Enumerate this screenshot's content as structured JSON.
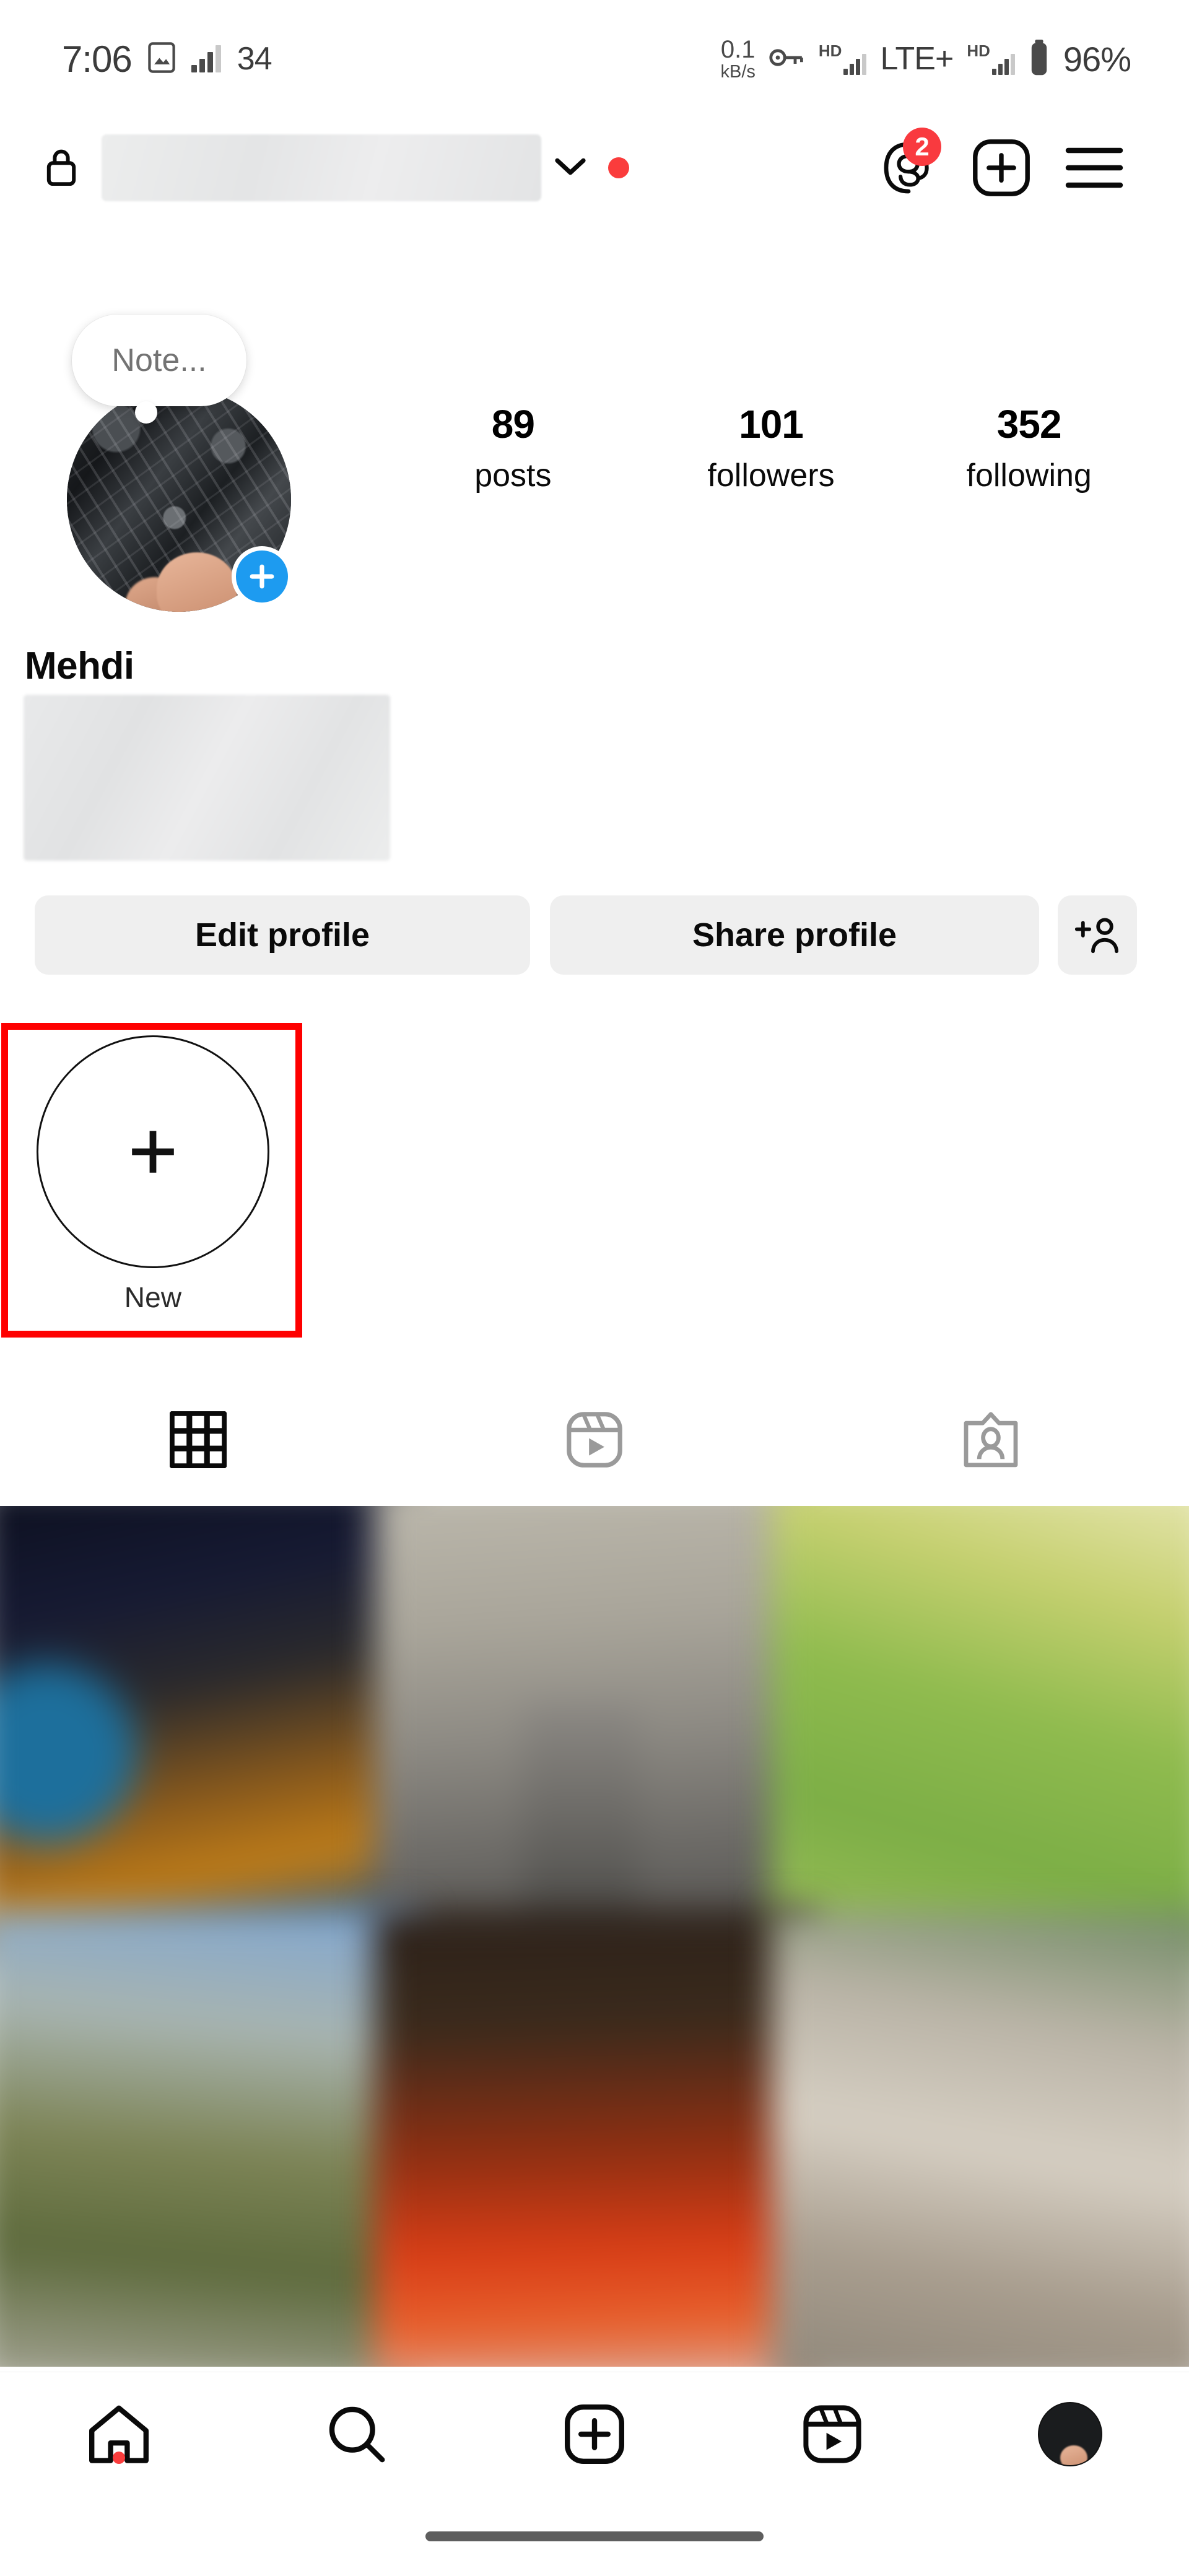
{
  "status_bar": {
    "time": "7:06",
    "gallery_icon": "image-icon",
    "signal_icon": "signal-bars-icon",
    "temperature": "34",
    "data_speed_value": "0.1",
    "data_speed_unit": "kB/s",
    "vpn_icon": "key-icon",
    "hd_label_1": "HD",
    "network_type": "LTE+",
    "hd_label_2": "HD",
    "battery_icon": "battery-icon",
    "battery_percent": "96%"
  },
  "header": {
    "lock_icon": "lock-icon",
    "username_redacted": true,
    "chevron_icon": "chevron-down-icon",
    "activity_dot": true,
    "threads_icon": "threads-icon",
    "threads_badge": "2",
    "create_icon": "plus-square-icon",
    "menu_icon": "hamburger-menu-icon"
  },
  "profile": {
    "note_text": "Note...",
    "avatar_icon": "profile-avatar",
    "add_story_icon": "plus-icon",
    "display_name": "Mehdi",
    "bio_redacted": true,
    "stats": [
      {
        "number": "89",
        "label": "posts"
      },
      {
        "number": "101",
        "label": "followers"
      },
      {
        "number": "352",
        "label": "following"
      }
    ]
  },
  "actions": {
    "edit_profile": "Edit profile",
    "share_profile": "Share profile",
    "add_user_icon": "add-person-icon"
  },
  "highlights": {
    "new_label": "New",
    "new_icon": "plus-icon",
    "annotation_color": "#FE0000"
  },
  "content_tabs": [
    {
      "name": "grid",
      "icon": "grid-icon",
      "active": true
    },
    {
      "name": "reels",
      "icon": "reels-icon",
      "active": false
    },
    {
      "name": "tagged",
      "icon": "tagged-person-icon",
      "active": false
    }
  ],
  "photo_grid": {
    "blurred": true,
    "cells": [
      "c1",
      "c2",
      "c3",
      "c4",
      "c5",
      "c6"
    ]
  },
  "bottom_nav": [
    {
      "name": "home",
      "icon": "home-icon",
      "has_dot": true
    },
    {
      "name": "search",
      "icon": "search-icon",
      "has_dot": false
    },
    {
      "name": "create",
      "icon": "plus-square-icon",
      "has_dot": false
    },
    {
      "name": "reels",
      "icon": "reels-icon",
      "has_dot": false
    },
    {
      "name": "profile",
      "icon": "avatar-icon",
      "has_dot": false
    }
  ],
  "colors": {
    "accent_blue": "#1D9BF0",
    "notification_red": "#FA3C3C",
    "badge_red": "#F93A3F",
    "annotation_red": "#FE0000",
    "button_gray": "#EFEFEF"
  }
}
